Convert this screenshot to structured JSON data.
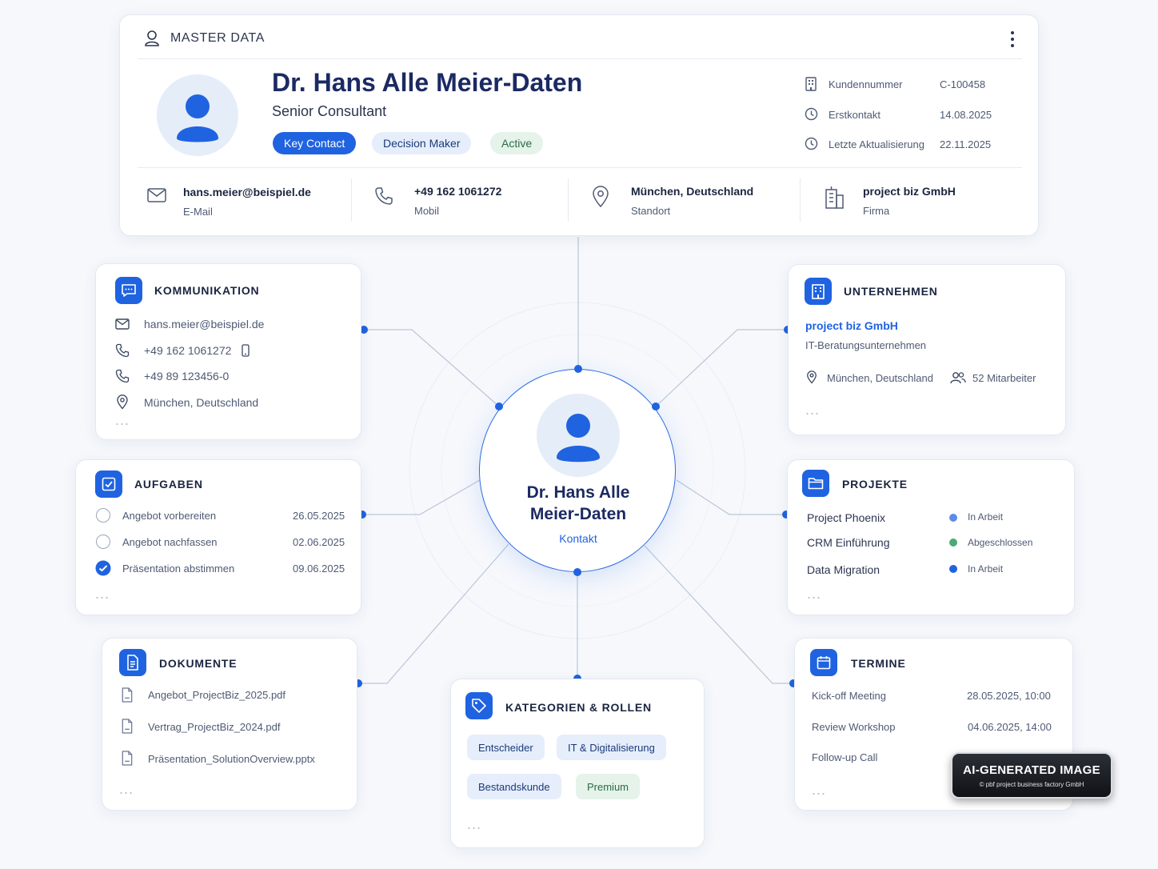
{
  "master": {
    "section_title": "MASTER DATA",
    "name": "Dr. Hans Alle Meier-Daten",
    "role": "Senior Consultant",
    "tags": [
      {
        "label": "Key Contact",
        "style": "primary"
      },
      {
        "label": "Decision Maker",
        "style": "light-blue"
      },
      {
        "label": "Active",
        "style": "light-green"
      }
    ],
    "meta": [
      {
        "icon": "building-icon",
        "label": "Kundennummer",
        "value": "C-100458"
      },
      {
        "icon": "clock-icon",
        "label": "Erstkontakt",
        "value": "14.08.2025"
      },
      {
        "icon": "clock-icon",
        "label": "Letzte Aktualisierung",
        "value": "22.11.2025"
      }
    ],
    "contacts": [
      {
        "icon": "mail-icon",
        "value": "hans.meier@beispiel.de",
        "label": "E-Mail"
      },
      {
        "icon": "phone-icon",
        "value": "+49 162 1061272",
        "label": "Mobil"
      },
      {
        "icon": "location-pin-icon",
        "value": "München, Deutschland",
        "label": "Standort"
      },
      {
        "icon": "office-building-icon",
        "value": "project biz GmbH",
        "label": "Firma"
      }
    ]
  },
  "center": {
    "name_line1": "Dr. Hans Alle",
    "name_line2": "Meier-Daten",
    "type": "Kontakt"
  },
  "kommunikation": {
    "title": "KOMMUNIKATION",
    "items": [
      {
        "icon": "mail-icon",
        "value": "hans.meier@beispiel.de"
      },
      {
        "icon": "phone-icon",
        "value": "+49 162 1061272"
      },
      {
        "icon": "phone-icon",
        "value": "+49 89 123456-0"
      },
      {
        "icon": "location-pin-icon",
        "value": "München, Deutschland"
      }
    ],
    "more": "..."
  },
  "aufgaben": {
    "title": "AUFGABEN",
    "items": [
      {
        "label": "Angebot vorbereiten",
        "date": "26.05.2025",
        "done": false
      },
      {
        "label": "Angebot nachfassen",
        "date": "02.06.2025",
        "done": false
      },
      {
        "label": "Präsentation abstimmen",
        "date": "09.06.2025",
        "done": true
      }
    ],
    "more": "..."
  },
  "dokumente": {
    "title": "DOKUMENTE",
    "items": [
      {
        "name": "Angebot_ProjectBiz_2025.pdf"
      },
      {
        "name": "Vertrag_ProjectBiz_2024.pdf"
      },
      {
        "name": "Präsentation_SolutionOverview.pptx"
      }
    ],
    "more": "..."
  },
  "unternehmen": {
    "title": "UNTERNEHMEN",
    "company": "project biz GmbH",
    "description": "IT-Beratungsunternehmen",
    "location": "München, Deutschland",
    "employees": "52 Mitarbeiter",
    "more": "..."
  },
  "projekte": {
    "title": "PROJEKTE",
    "items": [
      {
        "name": "Project Phoenix",
        "status": "In Arbeit",
        "color": "#5b8de6"
      },
      {
        "name": "CRM Einführung",
        "status": "Abgeschlossen",
        "color": "#4caa76"
      },
      {
        "name": "Data Migration",
        "status": "In Arbeit",
        "color": "#1f63e0"
      }
    ],
    "more": "..."
  },
  "termine": {
    "title": "TERMINE",
    "items": [
      {
        "name": "Kick-off Meeting",
        "datetime": "28.05.2025, 10:00"
      },
      {
        "name": "Review Workshop",
        "datetime": "04.06.2025, 14:00"
      },
      {
        "name": "Follow-up Call",
        "datetime": ""
      }
    ],
    "more": "..."
  },
  "kategorien": {
    "title": "KATEGORIEN & ROLLEN",
    "chips": [
      {
        "label": "Entscheider",
        "style": "blue"
      },
      {
        "label": "IT & Digitalisierung",
        "style": "blue"
      },
      {
        "label": "Bestandskunde",
        "style": "blue"
      },
      {
        "label": "Premium",
        "style": "green"
      }
    ],
    "more": "..."
  },
  "watermark": {
    "title": "AI-GENERATED IMAGE",
    "subtitle": "© pbf project business factory GmbH"
  },
  "colors": {
    "accent": "#1f63e0",
    "navy": "#1b2a63",
    "chip_blue_bg": "#e6eefb",
    "chip_green_bg": "#e5f3ea",
    "status_green": "#4caa76"
  }
}
